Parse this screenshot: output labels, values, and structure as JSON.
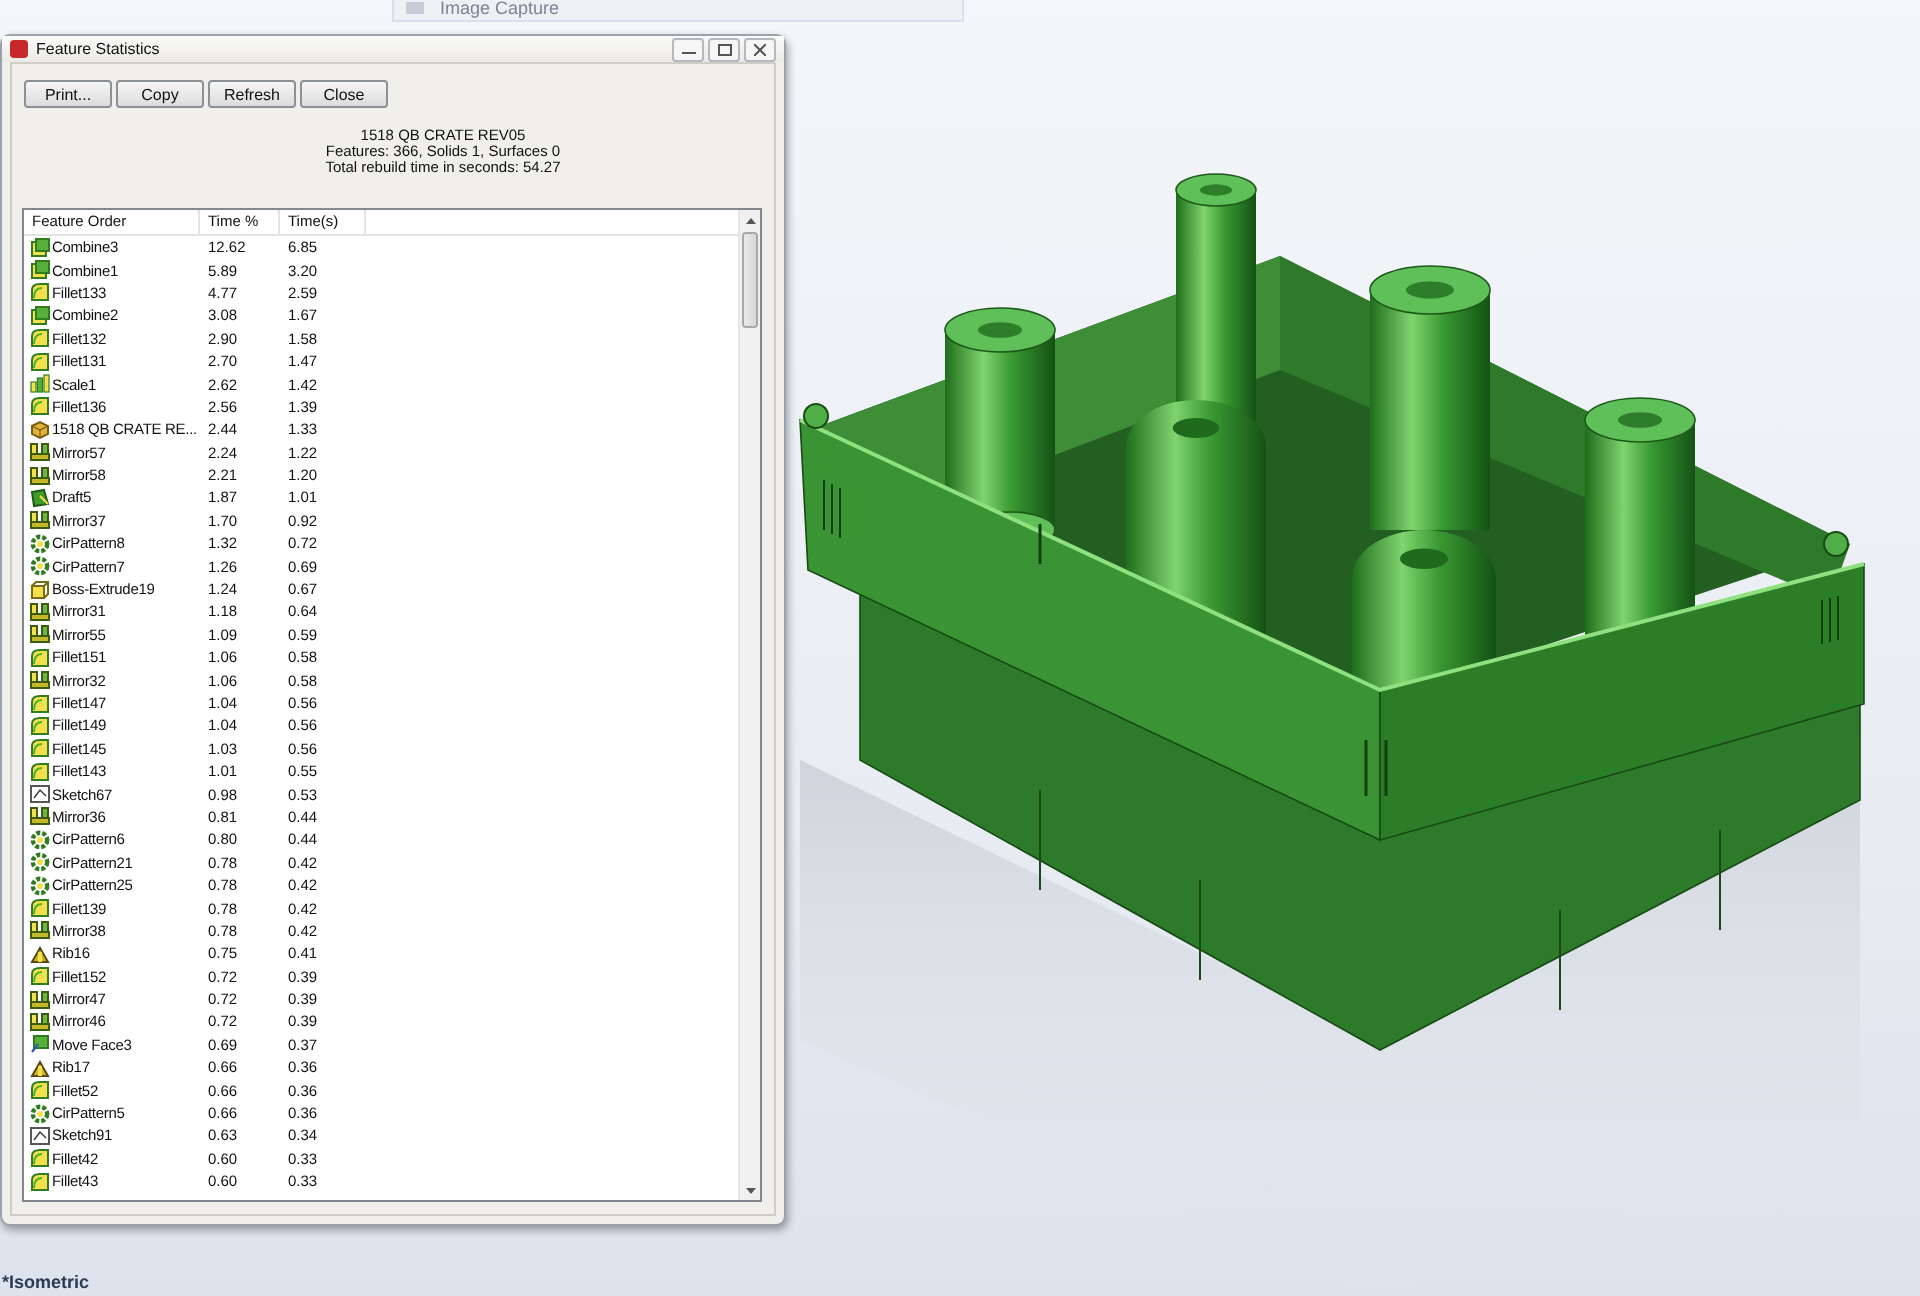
{
  "background_menu": {
    "item": "Image Capture"
  },
  "dialog": {
    "title": "Feature Statistics",
    "buttons": [
      "Print...",
      "Copy",
      "Refresh",
      "Close"
    ],
    "summary": [
      "1518 QB CRATE REV05",
      "Features: 366, Solids 1, Surfaces 0",
      "Total rebuild time in seconds: 54.27"
    ],
    "table": {
      "columns": [
        "Feature Order",
        "Time %",
        "Time(s)"
      ],
      "rows": [
        {
          "kind": "combine",
          "name": "Combine3",
          "time_percent": "12.62",
          "time_s": "6.85"
        },
        {
          "kind": "combine",
          "name": "Combine1",
          "time_percent": "5.89",
          "time_s": "3.20"
        },
        {
          "kind": "fillet",
          "name": "Fillet133",
          "time_percent": "4.77",
          "time_s": "2.59"
        },
        {
          "kind": "combine",
          "name": "Combine2",
          "time_percent": "3.08",
          "time_s": "1.67"
        },
        {
          "kind": "fillet",
          "name": "Fillet132",
          "time_percent": "2.90",
          "time_s": "1.58"
        },
        {
          "kind": "fillet",
          "name": "Fillet131",
          "time_percent": "2.70",
          "time_s": "1.47"
        },
        {
          "kind": "scale",
          "name": "Scale1",
          "time_percent": "2.62",
          "time_s": "1.42"
        },
        {
          "kind": "fillet",
          "name": "Fillet136",
          "time_percent": "2.56",
          "time_s": "1.39"
        },
        {
          "kind": "part",
          "name": "1518 QB CRATE RE...",
          "time_percent": "2.44",
          "time_s": "1.33"
        },
        {
          "kind": "mirror",
          "name": "Mirror57",
          "time_percent": "2.24",
          "time_s": "1.22"
        },
        {
          "kind": "mirror",
          "name": "Mirror58",
          "time_percent": "2.21",
          "time_s": "1.20"
        },
        {
          "kind": "draft",
          "name": "Draft5",
          "time_percent": "1.87",
          "time_s": "1.01"
        },
        {
          "kind": "mirror",
          "name": "Mirror37",
          "time_percent": "1.70",
          "time_s": "0.92"
        },
        {
          "kind": "pattern",
          "name": "CirPattern8",
          "time_percent": "1.32",
          "time_s": "0.72"
        },
        {
          "kind": "pattern",
          "name": "CirPattern7",
          "time_percent": "1.26",
          "time_s": "0.69"
        },
        {
          "kind": "extrude",
          "name": "Boss-Extrude19",
          "time_percent": "1.24",
          "time_s": "0.67"
        },
        {
          "kind": "mirror",
          "name": "Mirror31",
          "time_percent": "1.18",
          "time_s": "0.64"
        },
        {
          "kind": "mirror",
          "name": "Mirror55",
          "time_percent": "1.09",
          "time_s": "0.59"
        },
        {
          "kind": "fillet",
          "name": "Fillet151",
          "time_percent": "1.06",
          "time_s": "0.58"
        },
        {
          "kind": "mirror",
          "name": "Mirror32",
          "time_percent": "1.06",
          "time_s": "0.58"
        },
        {
          "kind": "fillet",
          "name": "Fillet147",
          "time_percent": "1.04",
          "time_s": "0.56"
        },
        {
          "kind": "fillet",
          "name": "Fillet149",
          "time_percent": "1.04",
          "time_s": "0.56"
        },
        {
          "kind": "fillet",
          "name": "Fillet145",
          "time_percent": "1.03",
          "time_s": "0.56"
        },
        {
          "kind": "fillet",
          "name": "Fillet143",
          "time_percent": "1.01",
          "time_s": "0.55"
        },
        {
          "kind": "sketch",
          "name": "Sketch67",
          "time_percent": "0.98",
          "time_s": "0.53"
        },
        {
          "kind": "mirror",
          "name": "Mirror36",
          "time_percent": "0.81",
          "time_s": "0.44"
        },
        {
          "kind": "pattern",
          "name": "CirPattern6",
          "time_percent": "0.80",
          "time_s": "0.44"
        },
        {
          "kind": "pattern",
          "name": "CirPattern21",
          "time_percent": "0.78",
          "time_s": "0.42"
        },
        {
          "kind": "pattern",
          "name": "CirPattern25",
          "time_percent": "0.78",
          "time_s": "0.42"
        },
        {
          "kind": "fillet",
          "name": "Fillet139",
          "time_percent": "0.78",
          "time_s": "0.42"
        },
        {
          "kind": "mirror",
          "name": "Mirror38",
          "time_percent": "0.78",
          "time_s": "0.42"
        },
        {
          "kind": "rib",
          "name": "Rib16",
          "time_percent": "0.75",
          "time_s": "0.41"
        },
        {
          "kind": "fillet",
          "name": "Fillet152",
          "time_percent": "0.72",
          "time_s": "0.39"
        },
        {
          "kind": "mirror",
          "name": "Mirror47",
          "time_percent": "0.72",
          "time_s": "0.39"
        },
        {
          "kind": "mirror",
          "name": "Mirror46",
          "time_percent": "0.72",
          "time_s": "0.39"
        },
        {
          "kind": "moveface",
          "name": "Move Face3",
          "time_percent": "0.69",
          "time_s": "0.37"
        },
        {
          "kind": "rib",
          "name": "Rib17",
          "time_percent": "0.66",
          "time_s": "0.36"
        },
        {
          "kind": "fillet",
          "name": "Fillet52",
          "time_percent": "0.66",
          "time_s": "0.36"
        },
        {
          "kind": "pattern",
          "name": "CirPattern5",
          "time_percent": "0.66",
          "time_s": "0.36"
        },
        {
          "kind": "sketch",
          "name": "Sketch91",
          "time_percent": "0.63",
          "time_s": "0.34"
        },
        {
          "kind": "fillet",
          "name": "Fillet42",
          "time_percent": "0.60",
          "time_s": "0.33"
        },
        {
          "kind": "fillet",
          "name": "Fillet43",
          "time_percent": "0.60",
          "time_s": "0.33"
        }
      ]
    }
  },
  "viewport": {
    "view_label": "*Isometric"
  }
}
